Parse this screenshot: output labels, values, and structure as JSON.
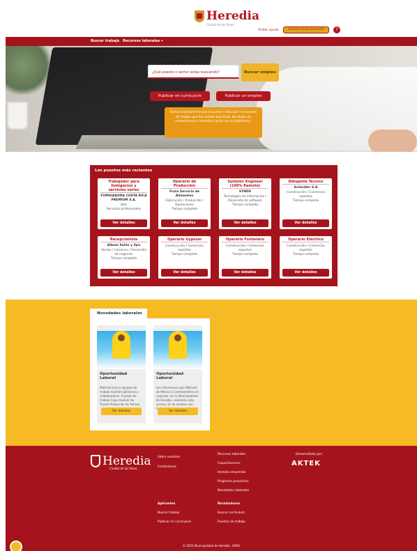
{
  "header": {
    "logo_name": "Heredia",
    "logo_sub": "Ciudad de las flores",
    "link_help": "Visitar ayuda",
    "cta": "Quiero iniciar personal",
    "avatar": "?"
  },
  "nav": {
    "items": [
      "Buscar trabajo",
      "Recursos laborales ▾"
    ]
  },
  "hero": {
    "search_placeholder": "¿Qué puesto o sector estás buscando?",
    "search_button": "Buscar empleo",
    "btn_resume": "Publicar mi currículum",
    "btn_job": "Publicar un empleo",
    "info": "Somos la plataforma que te puede a descubrir ese puesto de trabajo que has estado buscando. No dudes en contactarnos si necesitas ayuda con la plataforma."
  },
  "recent": {
    "title": "Los puestos más recientes",
    "cards": [
      {
        "title": "Trabajador para fumigacion y servicios varios",
        "company": "FUMIGADORA COSTA RICA PREMIUM S.A.",
        "category": "Otro\nServicios profesionales",
        "type": "",
        "button": "Ver detalles"
      },
      {
        "title": "Operario de Produccion",
        "company": "Fruta Servicio de Alimentos",
        "category": "Fabricación / Producción / Operaciones",
        "type": "Tiempo completo",
        "button": "Ver detalles"
      },
      {
        "title": "Systems Engineer (100% Remoto)",
        "company": "SYNDS",
        "category": "Tecnologías de información / Desarrollo de software",
        "type": "Tiempo completo",
        "button": "Ver detalles"
      },
      {
        "title": "Dibujante Tecnico",
        "company": "Schindler S.A",
        "category": "Construcción / Comercios expertos",
        "type": "Tiempo completo",
        "button": "Ver detalles"
      },
      {
        "title": "Recepcionista",
        "company": "Album Salón y Spa",
        "category": "Ventas / Comercio / Desarrollo de negocios",
        "type": "Tiempo completo",
        "button": "Ver detalles"
      },
      {
        "title": "Operario Gypsum",
        "company": "",
        "category": "Construcción / Comercios expertos",
        "type": "Tiempo completo",
        "button": "Ver detalles"
      },
      {
        "title": "Operario Fontanero",
        "company": "",
        "category": "Construcción / Comercios expertos",
        "type": "Tiempo completo",
        "button": "Ver detalles"
      },
      {
        "title": "Operario Eléctrico",
        "company": "",
        "category": "Construcción / Comercios expertos",
        "type": "Tiempo completo",
        "button": "Ver detalles"
      }
    ]
  },
  "news": {
    "tab": "Novedades laborales",
    "cards": [
      {
        "title": "Oportunidad Laboral",
        "text": "Walmart busca equipos de trabajo multidisciplinarios y colaboradores. Puestos de trabajo Cajas Auxiliar de Tienda Protección de Activos",
        "button": "Ver detalles"
      },
      {
        "title": "Oportunidad Laboral",
        "text": "Les informamos que Walmart de México y Centroamérica en conjunto con la Municipalidad de Heredia, realizarán este viernes 31 de octubre una Feria de",
        "button": "Ver detalles"
      }
    ]
  },
  "footer": {
    "logo_name": "Heredia",
    "logo_sub": "Ciudad de las flores",
    "col1": [
      "Sobre nosotros",
      "Contáctenos"
    ],
    "col2": [
      "Recursos laborales",
      "Capacitaciones",
      "Heredia emprende",
      "Programa proactivos",
      "Novedades laborales"
    ],
    "col3_title": "Aplicantes",
    "col3": [
      "Buscar trabajo",
      "Publicar mi currículum"
    ],
    "col4_title": "Reclutadores",
    "col4": [
      "Buscar currículum",
      "Puestos de trabajo"
    ],
    "dev_label": "Desarrollado por:",
    "dev_name": "AKTEK",
    "copyright": "© 2025 Municipalidad de Heredia · ESPH"
  },
  "colors": {
    "primary": "#a5141c",
    "accent": "#f6bb24",
    "orange": "#e89a17"
  }
}
